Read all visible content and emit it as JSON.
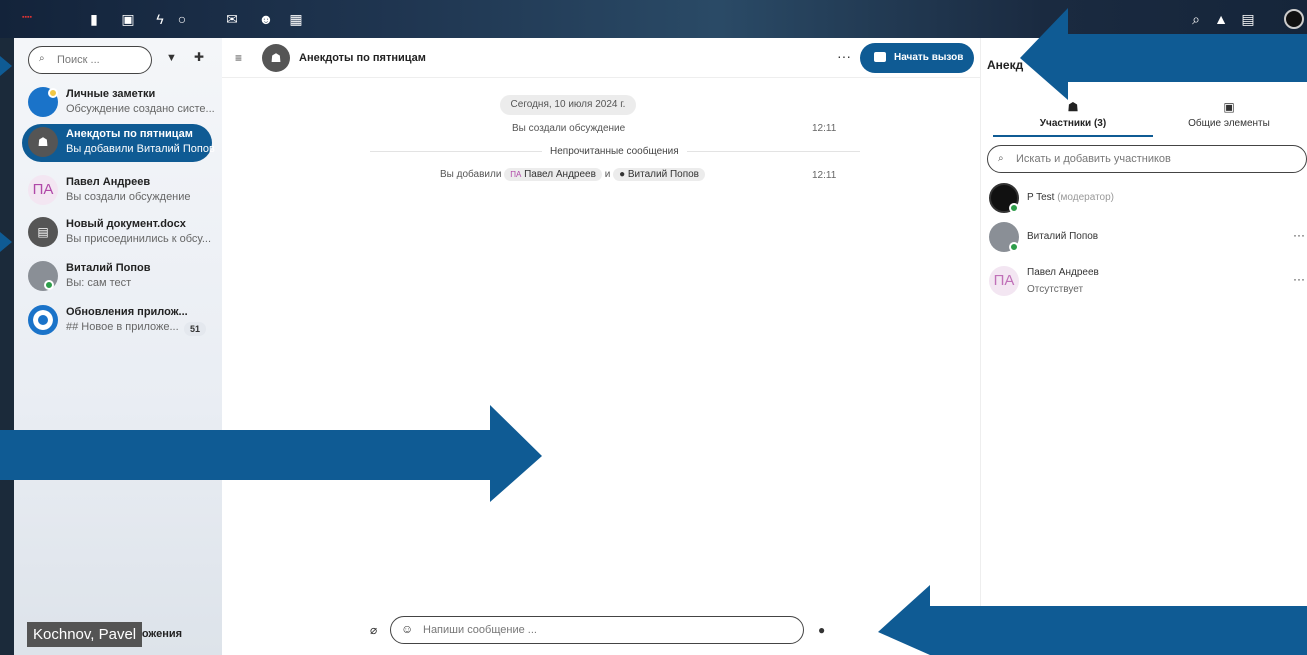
{
  "topbar": {
    "icons": [
      "files-icon",
      "photos-icon",
      "activity-icon",
      "talk-icon",
      "mail-icon",
      "contacts-icon",
      "calendar-icon"
    ],
    "right_icons": [
      "search-icon",
      "bell-icon",
      "contacts-menu-icon"
    ]
  },
  "sidebar": {
    "search_placeholder": "Поиск ...",
    "conversations": [
      {
        "title": "Личные заметки",
        "subtitle": "Обсуждение создано систе...",
        "avatar": "notes-icon",
        "color": "#1a73c9"
      },
      {
        "title": "Анекдоты по пятницам",
        "subtitle": "Вы добавили Виталий Попов",
        "avatar": "group-icon",
        "color": "#555555"
      },
      {
        "title": "Павел Андреев",
        "subtitle": "Вы создали обсуждение",
        "avatar": "ПА",
        "color": "#b048a8"
      },
      {
        "title": "Новый документ.docx",
        "subtitle": "Вы присоединились к обсу...",
        "avatar": "document-icon",
        "color": "#555555"
      },
      {
        "title": "Виталий Попов",
        "subtitle": "Вы: сам тест",
        "avatar": "photo",
        "color": "#777777"
      },
      {
        "title": "Обновления прилож...",
        "subtitle": "## Новое в приложе...",
        "avatar": "app-logo-icon",
        "color": "#1a73c9",
        "badge": "51"
      }
    ],
    "bottom_label": "ложения"
  },
  "caption": {
    "user": "Kochnov, Pavel"
  },
  "chat": {
    "title": "Анекдоты по пятницам",
    "call_button": "Начать вызов",
    "date": "Сегодня, 10 июля 2024 г.",
    "system_messages": [
      {
        "text": "Вы создали обсуждение",
        "time": "12:11"
      }
    ],
    "unread_label": "Непрочитанные сообщения",
    "added_message": {
      "prefix": "Вы добавили",
      "user1": "Павел Андреев",
      "conj": "и",
      "user2": "Виталий Попов",
      "time": "12:11"
    },
    "composer_placeholder": "Напиши сообщение ..."
  },
  "right_panel": {
    "title": "Анекд",
    "tabs": [
      {
        "label": "Участники (3)",
        "icon": "participants-icon",
        "active": true
      },
      {
        "label": "Общие элементы",
        "icon": "shared-items-icon",
        "active": false
      }
    ],
    "search_placeholder": "Искать и добавить участников",
    "participants": [
      {
        "name": "P Test",
        "role": "(модератор)",
        "status": ""
      },
      {
        "name": "Виталий Попов",
        "role": "",
        "status": ""
      },
      {
        "name": "Павел Андреев",
        "role": "",
        "status": "Отсутствует",
        "initials": "ПА"
      }
    ]
  },
  "colors": {
    "accent": "#0f5b94",
    "online": "#2e9d4a"
  }
}
